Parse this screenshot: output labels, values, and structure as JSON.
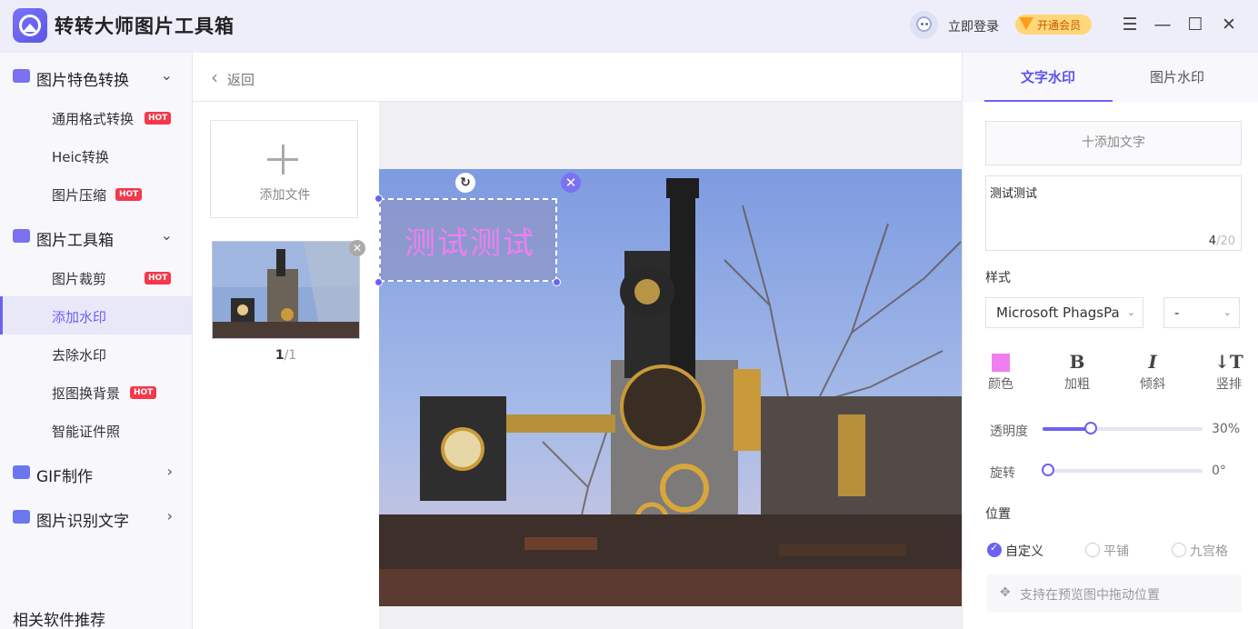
{
  "app": {
    "title": "转转大师图片工具箱"
  },
  "header": {
    "login_label": "立即登录",
    "vip_label": "开通会员"
  },
  "window_controls": {
    "menu": "☰",
    "minimize": "—",
    "maximize": "☐",
    "close": "✕"
  },
  "sidebar": {
    "categories": [
      {
        "label": "图片特色转换",
        "icon": "image-convert-icon",
        "expanded": true,
        "color": "#7a72f2"
      },
      {
        "label": "图片工具箱",
        "icon": "toolbox-icon",
        "expanded": true,
        "color": "#7a72f2"
      },
      {
        "label": "GIF制作",
        "icon": "gif-icon",
        "expanded": false,
        "color": "#6a78f0"
      },
      {
        "label": "图片识别文字",
        "icon": "ocr-icon",
        "expanded": false,
        "color": "#6a78f0"
      }
    ],
    "items": [
      {
        "label": "通用格式转换",
        "hot": "HOT"
      },
      {
        "label": "Heic转换"
      },
      {
        "label": "图片压缩",
        "hot": "HOT"
      },
      {
        "label": "图片裁剪",
        "hot": "HOT"
      },
      {
        "label": "添加水印",
        "active": true
      },
      {
        "label": "去除水印"
      },
      {
        "label": "抠图换背景",
        "hot": "HOT"
      },
      {
        "label": "智能证件照"
      }
    ],
    "recommend_label": "相关软件推荐"
  },
  "nav": {
    "back_label": "返回"
  },
  "files": {
    "add_label": "添加文件",
    "current": "1",
    "total": "/1"
  },
  "preview": {
    "watermark_text": "测试测试"
  },
  "panel": {
    "tabs": [
      {
        "label": "文字水印",
        "active": true
      },
      {
        "label": "图片水印"
      }
    ],
    "add_text_label": "十添加文字",
    "text_value": "测试测试",
    "char_count": "4",
    "char_max": "/20",
    "style_label": "样式",
    "font_value": "Microsoft PhagsPa",
    "size_value": "-",
    "buttons": [
      {
        "label": "颜色",
        "glyph": ""
      },
      {
        "label": "加粗",
        "glyph": "B"
      },
      {
        "label": "倾斜",
        "glyph": "I"
      },
      {
        "label": "竖排",
        "glyph": "↓T"
      }
    ],
    "watermark_color": "#f07ef0",
    "opacity": {
      "label": "透明度",
      "value_text": "30%",
      "value": 30
    },
    "rotation": {
      "label": "旋转",
      "value_text": "0°",
      "value": 0
    },
    "position_label": "位置",
    "positions": [
      {
        "label": "自定义",
        "selected": true
      },
      {
        "label": "平铺"
      },
      {
        "label": "九宫格"
      }
    ],
    "hint": "支持在预览图中拖动位置"
  },
  "accent_color": "#6b62f0"
}
